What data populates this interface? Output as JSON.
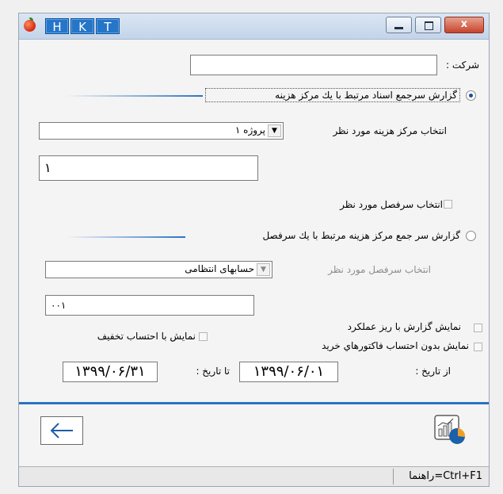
{
  "titlebar": {
    "buttons": [
      "H",
      "K",
      "T"
    ],
    "close_label": "x"
  },
  "company": {
    "label": "شرکت :",
    "value": ""
  },
  "option1": {
    "label": "گزارش سرجمع اسناد مرتبط با یك مرکز هزینه",
    "selected": true,
    "cost_center_label": "انتخاب مرکز هزینه مورد نظر",
    "cost_center_value": "پروژه ۱",
    "code_value": "۱",
    "select_account_label": "انتخاب سرفصل مورد نظر"
  },
  "option2": {
    "label": "گزارش سر جمع مرکز هزینه مرتبط با یك سرفصل",
    "selected": false,
    "account_label": "انتخاب سرفصل مورد نظر",
    "account_value": "حسابهای انتظامی",
    "account_code": "۰۰۱"
  },
  "checks": {
    "detail": "نمایش گزارش با ریز عملکرد",
    "discount": "نمایش با احتساب تخفیف",
    "no_purchase": "نمایش بدون احتساب فاکتورهاي خريد"
  },
  "dates": {
    "from_label": "از تاریخ :",
    "from_value": "۱۳۹۹/۰۶/۰۱",
    "to_label": "تا تاریخ :",
    "to_value": "۱۳۹۹/۰۶/۳۱"
  },
  "status": {
    "help": "راهنما=Ctrl+F1"
  },
  "colors": {
    "accent": "#2a73c4",
    "title_button": "#2575c8"
  },
  "icons": {
    "back": "arrow-left-icon",
    "report": "chart-report-icon"
  }
}
